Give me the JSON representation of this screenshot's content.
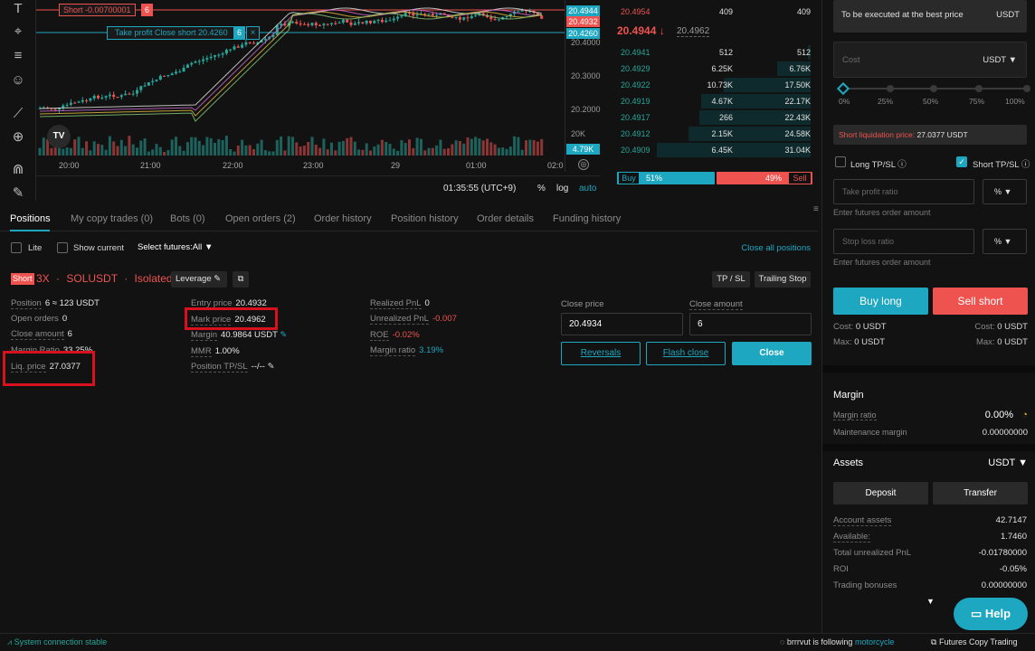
{
  "colors": {
    "up": "#26a69a",
    "down": "#ef5350",
    "accent": "#1ea7c0",
    "highlight": "#d9101e"
  },
  "chart": {
    "short_order_label": "Short -0.00700001",
    "short_order_qty": "6",
    "tp_label": "Take profit Close short 20.4260",
    "tp_qty": "6",
    "price_tags": [
      "20.4944",
      "20.4932",
      "20.4260"
    ],
    "price_labels": [
      "20.4000",
      "20.3000",
      "20.2000"
    ],
    "vol_label": "20K",
    "vol_tag": "4.79K",
    "time_labels": [
      "20:00",
      "21:00",
      "22:00",
      "23:00",
      "29",
      "01:00",
      "02:0"
    ],
    "clock": "01:35:55 (UTC+9)",
    "pct": "%",
    "log": "log",
    "auto": "auto",
    "logo": "TV"
  },
  "orderbook": {
    "ask_top": {
      "price": "20.4954",
      "amount": "409",
      "total": "409"
    },
    "last_price": "20.4944",
    "last_arrow": "↓",
    "mark_price": "20.4962",
    "bids": [
      {
        "price": "20.4941",
        "amount": "512",
        "total": "512"
      },
      {
        "price": "20.4929",
        "amount": "6.25K",
        "total": "6.76K"
      },
      {
        "price": "20.4922",
        "amount": "10.73K",
        "total": "17.50K"
      },
      {
        "price": "20.4919",
        "amount": "4.67K",
        "total": "22.17K"
      },
      {
        "price": "20.4917",
        "amount": "266",
        "total": "22.43K"
      },
      {
        "price": "20.4912",
        "amount": "2.15K",
        "total": "24.58K"
      },
      {
        "price": "20.4909",
        "amount": "6.45K",
        "total": "31.04K"
      }
    ],
    "buy_label": "Buy",
    "buy_pct": "51%",
    "sell_pct": "49%",
    "sell_label": "Sell",
    "buy_ratio": 51
  },
  "tabs": [
    "Positions",
    "My copy trades (0)",
    "Bots (0)",
    "Open orders (2)",
    "Order history",
    "Position history",
    "Order details",
    "Funding history"
  ],
  "filters": {
    "lite": "Lite",
    "show_current": "Show current",
    "select_futures": "Select futures:All",
    "close_all": "Close all positions"
  },
  "position": {
    "side": "Short",
    "leverage": "3X",
    "sep": "·",
    "symbol": "SOLUSDT",
    "mode": "Isolated",
    "leverage_btn": "Leverage",
    "tpsl_btn": "TP / SL",
    "trailing_btn": "Trailing Stop",
    "col1": [
      {
        "k": "Position",
        "v": "6 ≈ 123 USDT"
      },
      {
        "k": "Open orders",
        "v": "0"
      },
      {
        "k": "Close amount",
        "v": "6"
      },
      {
        "k": "Margin Ratio",
        "v": "33.25%"
      },
      {
        "k": "Liq. price",
        "v": "27.0377"
      }
    ],
    "col2": [
      {
        "k": "Entry price",
        "v": "20.4932"
      },
      {
        "k": "Mark price",
        "v": "20.4962"
      },
      {
        "k": "Margin",
        "v": "40.9864 USDT"
      },
      {
        "k": "MMR",
        "v": "1.00%"
      },
      {
        "k": "Position TP/SL",
        "v": "--/--"
      }
    ],
    "col3": [
      {
        "k": "Realized PnL",
        "v": "0"
      },
      {
        "k": "Unrealized PnL",
        "v": "-0.007"
      },
      {
        "k": "ROE",
        "v": "-0.02%"
      },
      {
        "k": "Margin ratio",
        "v": "3.19%"
      }
    ],
    "close_price_label": "Close price",
    "close_amount_label": "Close amount",
    "close_price": "20.4934",
    "close_amount": "6",
    "reversals": "Reversals",
    "flash_close": "Flash close",
    "close": "Close"
  },
  "right": {
    "best_price": "To be executed at the best price",
    "best_unit": "USDT",
    "cost_placeholder": "Cost",
    "cost_unit": "USDT",
    "slider_labels": [
      "0%",
      "25%",
      "50%",
      "75%",
      "100%"
    ],
    "liq_label": "Short liquidation price:",
    "liq_value": "27.0377 USDT",
    "long_tpsl": "Long TP/SL",
    "short_tpsl": "Short TP/SL",
    "tp_placeholder": "Take profit ratio",
    "tp_unit": "%",
    "tp_hint": "Enter futures order amount",
    "sl_placeholder": "Stop loss ratio",
    "sl_unit": "%",
    "sl_hint": "Enter futures order amount",
    "buy_long": "Buy long",
    "sell_short": "Sell short",
    "cost_l": "Cost:",
    "cost_lv": "0 USDT",
    "cost_r": "Cost:",
    "cost_rv": "0 USDT",
    "max_l": "Max:",
    "max_lv": "0 USDT",
    "max_r": "Max:",
    "max_rv": "0 USDT",
    "margin_title": "Margin",
    "margin_ratio_label": "Margin ratio",
    "margin_ratio": "0.00%",
    "maint_label": "Maintenance margin",
    "maint_value": "0.00000000",
    "assets_title": "Assets",
    "assets_unit": "USDT",
    "deposit": "Deposit",
    "transfer": "Transfer",
    "rows": [
      {
        "k": "Account assets",
        "v": "42.7147"
      },
      {
        "k": "Available:",
        "v": "1.7460"
      },
      {
        "k": "Total unrealized PnL",
        "v": "-0.01780000"
      },
      {
        "k": "ROI",
        "v": "-0.05%"
      },
      {
        "k": "Trading bonuses",
        "v": "0.00000000"
      }
    ],
    "help": "Help"
  },
  "status": {
    "connection": "System connection stable",
    "user": "brrrvut",
    "following_text": "is following",
    "follow_target": "motorcycle",
    "copy_trading": "Futures Copy Trading"
  }
}
